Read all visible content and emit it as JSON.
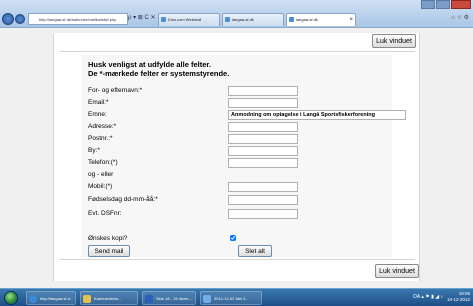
{
  "browser": {
    "address": "http://langaa-sf.dk/kalender/mailkontakt.php",
    "address_tools": "ρ ▾ ⊠ C ✕",
    "tabs": [
      {
        "label": "Dins.com Webmail"
      },
      {
        "label": "langaa-sf.dk"
      },
      {
        "label": "langaa-sf.dk",
        "close": "×"
      }
    ],
    "toolbar_icons": "⌂ ☆ ⚙"
  },
  "page": {
    "close_window_label": "Luk vinduet",
    "intro": {
      "line1": "Husk venligst at udfylde alle felter.",
      "line2": "De *-mærkede felter er systemstyrende."
    },
    "fields": {
      "name": {
        "label": "For- og efternavn:*",
        "value": ""
      },
      "email": {
        "label": "Email:*",
        "value": ""
      },
      "subject": {
        "label": "Emne:",
        "value": "Anmodning om optagelse i Langå Sportsfiskerforening"
      },
      "address": {
        "label": "Adresse:*",
        "value": ""
      },
      "postal": {
        "label": "Postnr.:*",
        "value": ""
      },
      "city": {
        "label": "By:*",
        "value": ""
      },
      "phone": {
        "label": "Telefon:(*)",
        "value": ""
      },
      "or_label": "og - eller",
      "mobile": {
        "label": "Mobil:(*)",
        "value": ""
      },
      "birthday": {
        "label": "Fødselsdag dd-mm-åå:*",
        "value": ""
      },
      "dsf": {
        "label": "Evt. DSFnr:",
        "value": ""
      },
      "copy": {
        "label": "Ønskes kopi?",
        "checked": true
      }
    },
    "send_label": "Send mail",
    "reset_label": "Slet alt"
  },
  "taskbar": {
    "items": [
      {
        "label": "http://langaa-sf.d..."
      },
      {
        "label": "Kalenderbeta..."
      },
      {
        "label": "Side 18 - 15 dkum..."
      },
      {
        "label": "2012-12-02 Mei 3..."
      }
    ],
    "tray_icons": "DA ▴ ⚑ ▮ ◢ ♪",
    "time": "19:05",
    "date": "10-12-2012"
  },
  "colors": {
    "taskbar": "#1c4f86",
    "chrome": "#a9c6e6",
    "button_border": "#6a8ab8"
  }
}
